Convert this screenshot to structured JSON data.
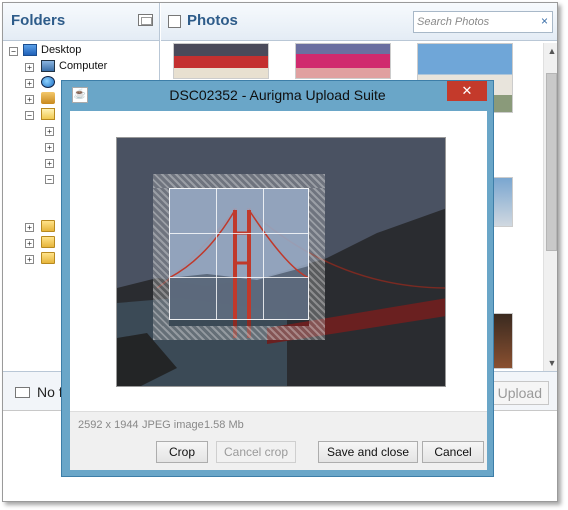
{
  "folders": {
    "title": "Folders",
    "tree": [
      {
        "label": "Desktop",
        "icon": "desktop-icon",
        "expander": "−"
      },
      {
        "label": "Computer",
        "icon": "computer-icon",
        "expander": "+"
      },
      {
        "label": "",
        "icon": "network-icon",
        "expander": "+"
      },
      {
        "label": "",
        "icon": "user-icon",
        "expander": "+"
      },
      {
        "label": "",
        "icon": "folder-open-icon",
        "expander": "−"
      },
      {
        "label": "",
        "icon": "",
        "expander": "+"
      },
      {
        "label": "",
        "icon": "",
        "expander": "+"
      },
      {
        "label": "",
        "icon": "",
        "expander": "+"
      },
      {
        "label": "",
        "icon": "",
        "expander": "−"
      },
      {
        "label": "",
        "icon": "folder-icon",
        "expander": "+"
      },
      {
        "label": "",
        "icon": "folder-icon",
        "expander": "+"
      },
      {
        "label": "",
        "icon": "folder-icon",
        "expander": "+"
      }
    ]
  },
  "photos": {
    "title": "Photos",
    "search_placeholder": "Search Photos",
    "clear_icon": "×"
  },
  "bottom": {
    "status_label": "No f",
    "upload_label": "Upload"
  },
  "dialog": {
    "title": "DSC02352 - Aurigma Upload Suite",
    "close_icon": "✕",
    "app_icon": "☕",
    "dimensions": "2592 x 1944",
    "type": "JPEG image",
    "size": "1.58 Mb",
    "buttons": {
      "crop": "Crop",
      "cancel_crop": "Cancel crop",
      "save_close": "Save and close",
      "cancel": "Cancel"
    }
  },
  "colors": {
    "dialog_frame": "#6aa6c8",
    "close_button": "#c43a2b",
    "header_text": "#2e5c8a"
  }
}
